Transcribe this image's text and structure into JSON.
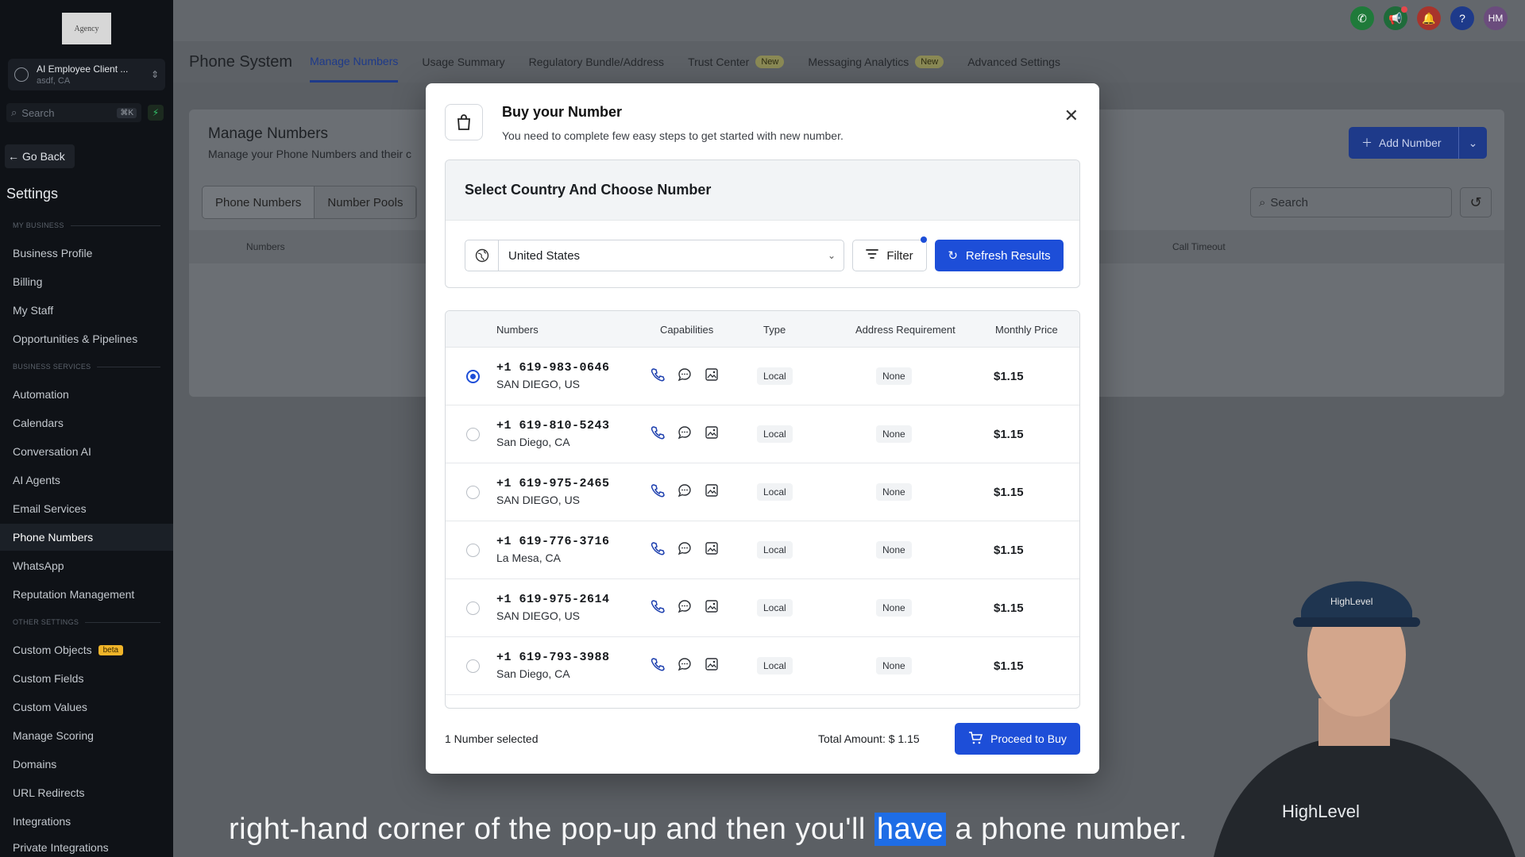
{
  "sidebar": {
    "logo_text": "Agency",
    "account": {
      "name": "AI Employee Client ...",
      "location": "asdf, CA"
    },
    "search_placeholder": "Search",
    "search_shortcut": "⌘K",
    "go_back": "Go Back",
    "settings_title": "Settings",
    "section_my_business": "MY BUSINESS",
    "section_business_services": "BUSINESS SERVICES",
    "section_other_settings": "OTHER SETTINGS",
    "items": [
      "Business Profile",
      "Billing",
      "My Staff",
      "Opportunities & Pipelines",
      "Automation",
      "Calendars",
      "Conversation AI",
      "AI Agents",
      "Email Services",
      "Phone Numbers",
      "WhatsApp",
      "Reputation Management",
      "Custom Objects",
      "Custom Fields",
      "Custom Values",
      "Manage Scoring",
      "Domains",
      "URL Redirects",
      "Integrations",
      "Private Integrations"
    ],
    "beta_label": "beta"
  },
  "topbar": {
    "avatar_initials": "HM"
  },
  "subnav": {
    "app_title": "Phone System",
    "tabs": [
      "Manage Numbers",
      "Usage Summary",
      "Regulatory Bundle/Address",
      "Trust Center",
      "Messaging Analytics",
      "Advanced Settings"
    ],
    "new_label": "New"
  },
  "page": {
    "title": "Manage Numbers",
    "subtitle": "Manage your Phone Numbers and their c",
    "add_number": "Add Number",
    "tabs": [
      "Phone Numbers",
      "Number Pools"
    ],
    "search_placeholder": "Search",
    "col_numbers": "Numbers",
    "col_call_timeout": "Call Timeout"
  },
  "modal": {
    "title": "Buy your Number",
    "subtitle": "You need to complete few easy steps to get started with new number.",
    "step_title": "Select Country And Choose Number",
    "country": "United States",
    "filter_label": "Filter",
    "refresh_label": "Refresh Results",
    "columns": {
      "numbers": "Numbers",
      "capabilities": "Capabilities",
      "type": "Type",
      "address": "Address Requirement",
      "price": "Monthly Price"
    },
    "rows": [
      {
        "number": "+1 619-983-0646",
        "city": "SAN DIEGO, US",
        "type": "Local",
        "address": "None",
        "price": "$1.15",
        "selected": true
      },
      {
        "number": "+1 619-810-5243",
        "city": "San Diego, CA",
        "type": "Local",
        "address": "None",
        "price": "$1.15",
        "selected": false
      },
      {
        "number": "+1 619-975-2465",
        "city": "SAN DIEGO, US",
        "type": "Local",
        "address": "None",
        "price": "$1.15",
        "selected": false
      },
      {
        "number": "+1 619-776-3716",
        "city": "La Mesa, CA",
        "type": "Local",
        "address": "None",
        "price": "$1.15",
        "selected": false
      },
      {
        "number": "+1 619-975-2614",
        "city": "SAN DIEGO, US",
        "type": "Local",
        "address": "None",
        "price": "$1.15",
        "selected": false
      },
      {
        "number": "+1 619-793-3988",
        "city": "San Diego, CA",
        "type": "Local",
        "address": "None",
        "price": "$1.15",
        "selected": false
      }
    ],
    "selected_count": "1 Number selected",
    "total": "Total Amount: $ 1.15",
    "proceed": "Proceed to Buy"
  },
  "overlay": {
    "caption_before": "right-hand corner of the pop-up and then you'll",
    "caption_highlight": "have",
    "caption_after": "a phone number.",
    "brand": "HighLevel"
  },
  "colors": {
    "primary": "#1d4ed8",
    "sidebar_bg": "#0f1217",
    "phone_icon": "#1e40af"
  }
}
